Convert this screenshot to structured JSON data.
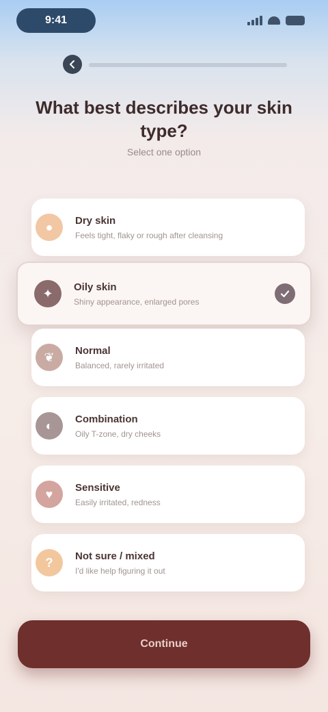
{
  "status_bar": {
    "time": "9:41"
  },
  "header": {
    "title": "What best describes your skin type?",
    "subtitle": "Select one option"
  },
  "options": [
    {
      "title": "Dry skin",
      "desc": "Feels tight, flaky or rough after cleansing",
      "icon": "droplet-icon",
      "color": "#f2c7a4",
      "selected": false
    },
    {
      "title": "Oily skin",
      "desc": "Shiny appearance, enlarged pores",
      "icon": "sparkle-icon",
      "color": "#8a6a6a",
      "selected": true
    },
    {
      "title": "Normal",
      "desc": "Balanced, rarely irritated",
      "icon": "leaf-icon",
      "color": "#c9aba4",
      "selected": false
    },
    {
      "title": "Combination",
      "desc": "Oily T-zone, dry cheeks",
      "icon": "half-circle-icon",
      "color": "#a89596",
      "selected": false
    },
    {
      "title": "Sensitive",
      "desc": "Easily irritated, redness",
      "icon": "heart-icon",
      "color": "#d4a49e",
      "selected": false
    },
    {
      "title": "Not sure / mixed",
      "desc": "I'd like help figuring it out",
      "icon": "question-icon",
      "color": "#f3c79d",
      "selected": false
    }
  ],
  "cta": {
    "label": "Continue"
  }
}
